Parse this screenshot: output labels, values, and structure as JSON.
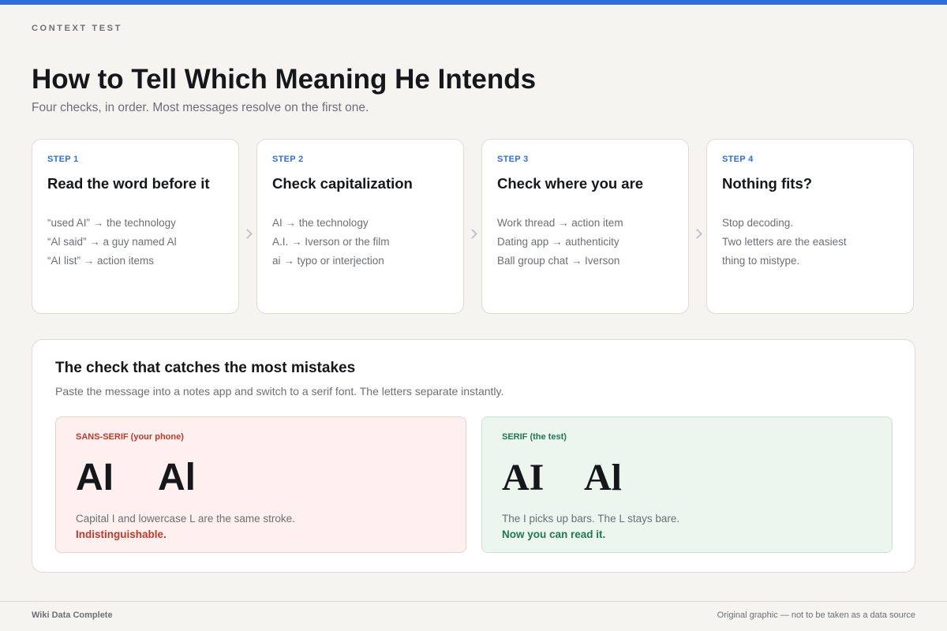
{
  "colors": {
    "accent": "#2f6fdb",
    "sans_label": "#c0392b",
    "sans_bg": "#fdf0ee",
    "sans_border": "#f0cfc8",
    "serif_label": "#1e7a4c",
    "serif_bg": "#ecf6ef",
    "serif_border": "#c9e3d2"
  },
  "header": {
    "kicker": "CONTEXT TEST",
    "title": "How to Tell Which Meaning He Intends",
    "subtitle": "Four checks, in order. Most messages resolve on the first one."
  },
  "steps": [
    {
      "label": "STEP 1",
      "title": "Read the word before it",
      "lines": [
        "“used AI” → the technology",
        "“Al said” → a guy named Al",
        "“AI list” → action items"
      ]
    },
    {
      "label": "STEP 2",
      "title": "Check capitalization",
      "lines": [
        "AI → the technology",
        "A.I. → Iverson or the film",
        "ai → typo or interjection"
      ]
    },
    {
      "label": "STEP 3",
      "title": "Check where you are",
      "lines": [
        "Work thread → action item",
        "Dating app → authenticity",
        "Ball group chat → Iverson"
      ]
    },
    {
      "label": "STEP 4",
      "title": "Nothing fits?",
      "lines": [
        "Stop decoding.",
        "Two letters are the easiest",
        "thing to mistype."
      ]
    }
  ],
  "comparison": {
    "title": "The check that catches the most mistakes",
    "subtitle": "Paste the message into a notes app and switch to a serif font. The letters separate instantly.",
    "sans": {
      "label": "SANS-SERIF (your phone)",
      "sample_a": "AI",
      "sample_b": "Al",
      "body": "Capital I and lowercase L are the same stroke.",
      "verdict": "Indistinguishable."
    },
    "serif": {
      "label": "SERIF (the test)",
      "sample_a": "AI",
      "sample_b": "Al",
      "body": "The I picks up bars. The L stays bare.",
      "verdict": "Now you can read it."
    }
  },
  "footer": {
    "left": "Wiki Data Complete",
    "right": "Original graphic — not to be taken as a data source"
  }
}
